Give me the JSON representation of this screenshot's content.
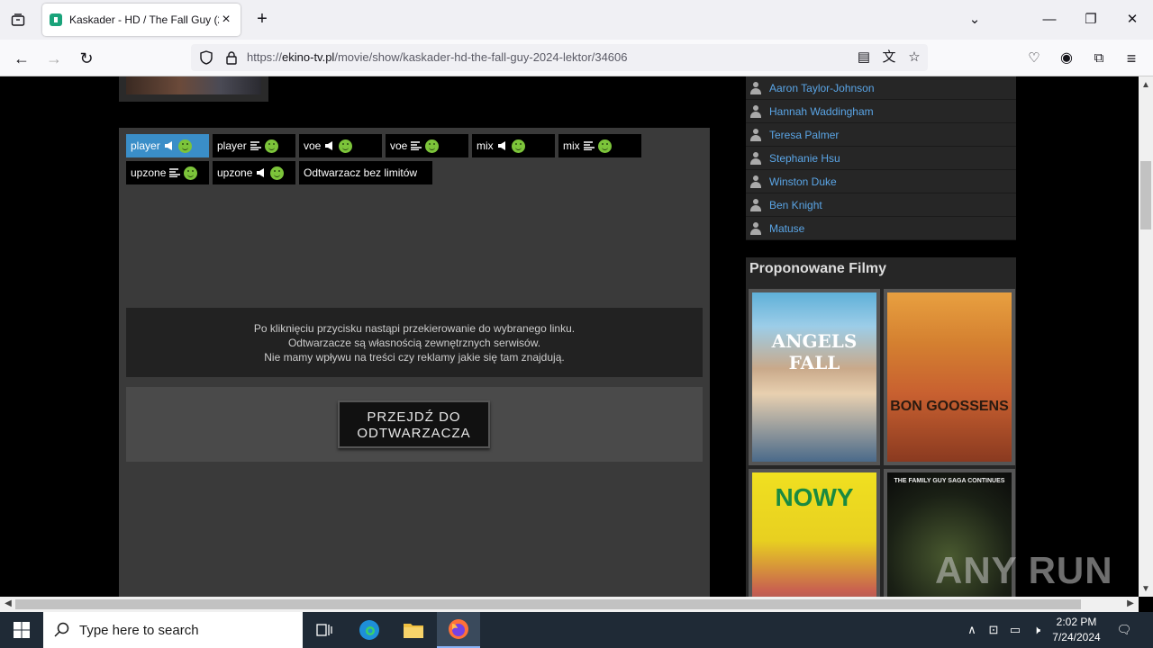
{
  "browser": {
    "tab_title": "Kaskader - HD / The Fall Guy (2",
    "url_prefix": "https://",
    "url_domain": "ekino-tv.pl",
    "url_path": "/movie/show/kaskader-hd-the-fall-guy-2024-lektor/34606"
  },
  "servers": [
    {
      "label": "player",
      "kind": "lektor",
      "active": true
    },
    {
      "label": "player",
      "kind": "napisy",
      "active": false
    },
    {
      "label": "voe",
      "kind": "lektor",
      "active": false
    },
    {
      "label": "voe",
      "kind": "napisy",
      "active": false
    },
    {
      "label": "mix",
      "kind": "lektor",
      "active": false
    },
    {
      "label": "mix",
      "kind": "napisy",
      "active": false
    },
    {
      "label": "upzone",
      "kind": "napisy",
      "active": false
    },
    {
      "label": "upzone",
      "kind": "lektor",
      "active": false
    },
    {
      "label": "Odtwarzacz bez limitów",
      "kind": "none",
      "active": false
    }
  ],
  "notice": {
    "line1": "Po kliknięciu przycisku nastąpi przekierowanie do wybranego linku.",
    "line2": "Odtwarzacze są własnością zewnętrznych serwisów.",
    "line3": "Nie mamy wpływu na treści czy reklamy jakie się tam znajdują."
  },
  "go_button": {
    "line1": "PRZEJDŹ DO",
    "line2": "ODTWARZACZA"
  },
  "cast": [
    "Aaron Taylor-Johnson",
    "Hannah Waddingham",
    "Teresa Palmer",
    "Stephanie Hsu",
    "Winston Duke",
    "Ben Knight",
    "Matuse"
  ],
  "proposed": {
    "heading": "Proponowane Filmy",
    "posters": [
      {
        "caption": "ANGELS FALL"
      },
      {
        "caption": "BON GOOSSENS"
      },
      {
        "caption": "NOWY"
      },
      {
        "caption": "THE FAMILY GUY SAGA CONTINUES"
      }
    ]
  },
  "taskbar": {
    "search_placeholder": "Type here to search",
    "time": "2:02 PM",
    "date": "7/24/2024"
  },
  "watermark": "ANY RUN"
}
